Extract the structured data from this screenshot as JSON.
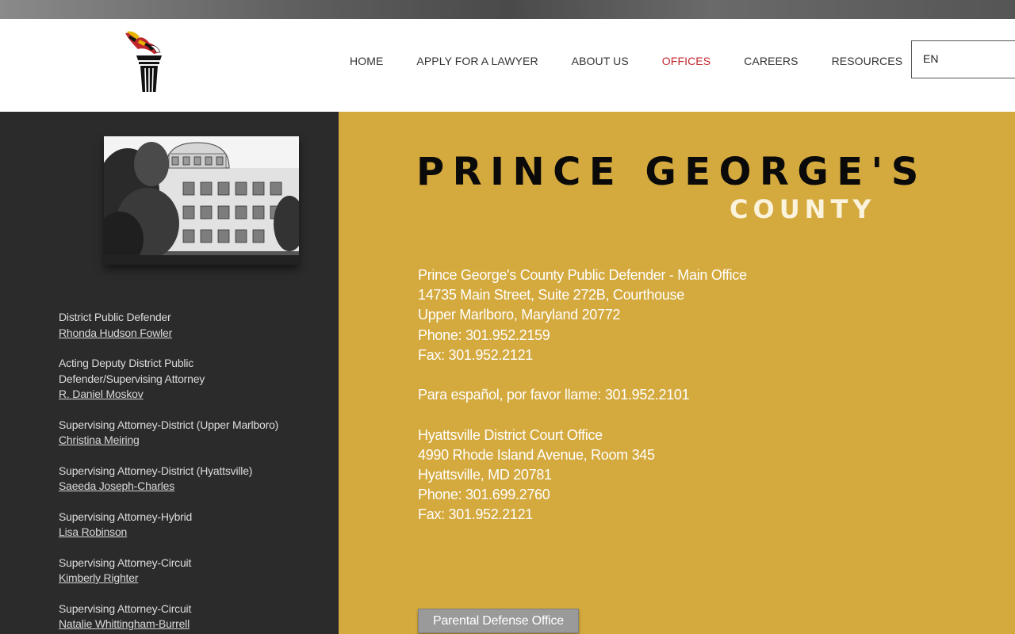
{
  "nav": {
    "items": [
      {
        "label": "HOME",
        "active": false
      },
      {
        "label": "APPLY FOR A LAWYER",
        "active": false
      },
      {
        "label": "ABOUT US",
        "active": false
      },
      {
        "label": "OFFICES",
        "active": true
      },
      {
        "label": "CAREERS",
        "active": false
      },
      {
        "label": "RESOURCES",
        "active": false
      }
    ],
    "active_color": "#c0272d"
  },
  "language": {
    "selected": "EN"
  },
  "logo": {
    "icon": "torch-icon"
  },
  "sidebar": {
    "photo": "office-building-photo",
    "staff": [
      {
        "title": [
          "District Public Defender"
        ],
        "name": "Rhonda Hudson Fowler"
      },
      {
        "title": [
          "Acting Deputy District Public",
          "Defender/Supervising Attorney"
        ],
        "name": "R. Daniel Moskov"
      },
      {
        "title": [
          "Supervising Attorney-District (Upper Marlboro)"
        ],
        "name": "Christina Meiring"
      },
      {
        "title": [
          "Supervising Attorney-District (Hyattsville)"
        ],
        "name": "Saeeda Joseph-Charles"
      },
      {
        "title": [
          "Supervising Attorney-Hybrid"
        ],
        "name": "Lisa Robinson"
      },
      {
        "title": [
          "Supervising Attorney-Circuit"
        ],
        "name": "Kimberly Righter"
      },
      {
        "title": [
          "Supervising Attorney-Circuit"
        ],
        "name": "Natalie Whittingham-Burrell"
      }
    ]
  },
  "main": {
    "title": "PRINCE GEORGE'S",
    "subtitle": "COUNTY",
    "background_color": "#d4a93d",
    "offices": {
      "main_office": [
        "Prince George's County Public Defender - Main Office",
        "14735 Main Street, Suite 272B, Courthouse",
        "Upper Marlboro, Maryland 20772",
        "Phone: 301.952.2159",
        "Fax: 301.952.2121"
      ],
      "spanish_line": "Para español, por favor llame: 301.952.2101",
      "hyattsville_office": [
        "Hyattsville District Court Office",
        "4990 Rhode Island Avenue, Room 345",
        "Hyattsville, MD 20781",
        "Phone: 301.699.2760",
        "Fax: 301.952.2121"
      ]
    },
    "parental_button_label": "Parental Defense Office"
  }
}
